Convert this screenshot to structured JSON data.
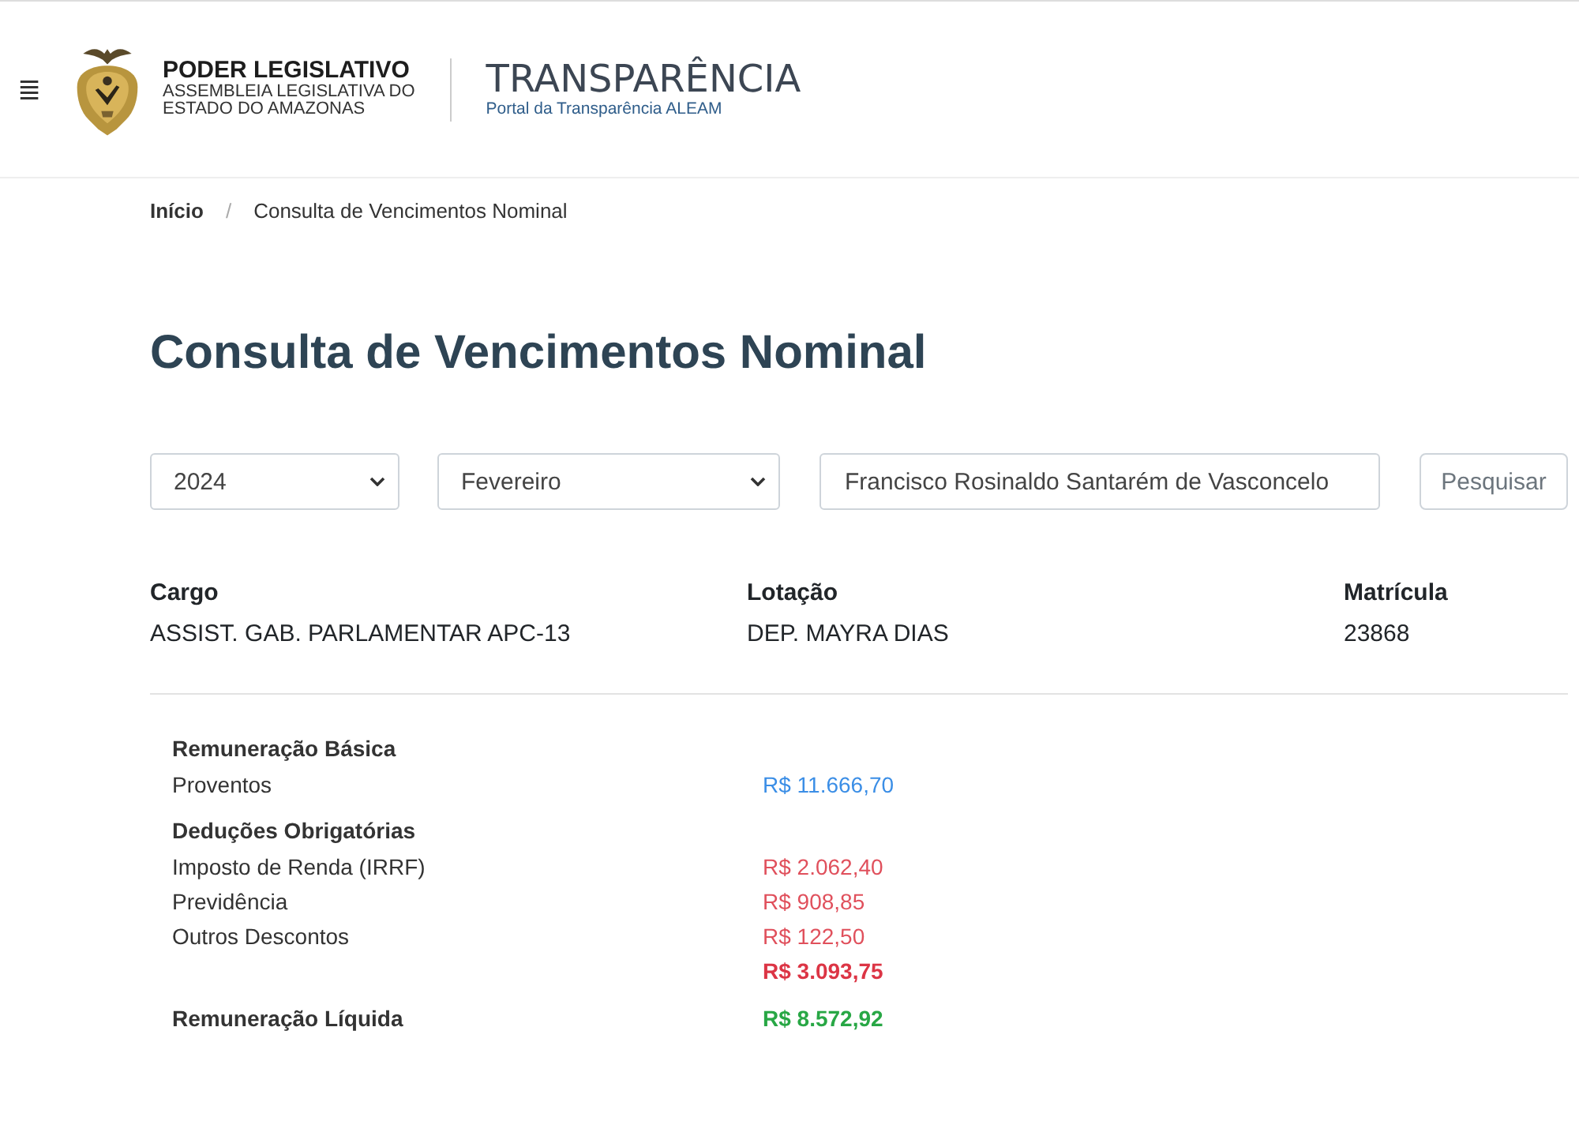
{
  "header": {
    "menu_icon": "≣",
    "org_title": "PODER LEGISLATIVO",
    "org_subtitle_1": "ASSEMBLEIA LEGISLATIVA DO",
    "org_subtitle_2": "ESTADO DO AMAZONAS",
    "portal_title": "TRANSPARÊNCIA",
    "portal_subtitle": "Portal da Transparência ALEAM"
  },
  "breadcrumb": [
    {
      "label": "Início",
      "selected": false
    },
    {
      "label": "Consulta de Vencimentos Nominal",
      "selected": true
    }
  ],
  "breadcrumb_separator": "/",
  "page_title": "Consulta de Vencimentos Nominal",
  "filters": {
    "year": "2024",
    "month": "Fevereiro",
    "name": "Francisco Rosinaldo Santarém de Vasconcelo",
    "search_button": "Pesquisar"
  },
  "info": [
    {
      "label": "Cargo",
      "value": "ASSIST. GAB. PARLAMENTAR APC-13"
    },
    {
      "label": "Lotação",
      "value": "DEP. MAYRA DIAS"
    },
    {
      "label": "Matrícula",
      "value": "23868"
    }
  ],
  "summary": [
    {
      "kind": "section",
      "label": "Remuneração Básica"
    },
    {
      "kind": "earning",
      "label": "Proventos",
      "amount": "R$ 11.666,70"
    },
    {
      "kind": "section",
      "label": "Deduções Obrigatórias"
    },
    {
      "kind": "deduction",
      "label": "Imposto de Renda (IRRF)",
      "amount": "R$ 2.062,40"
    },
    {
      "kind": "deduction",
      "label": "Previdência",
      "amount": "R$ 908,85"
    },
    {
      "kind": "deduction",
      "label": "Outros Descontos",
      "amount": "R$ 122,50"
    },
    {
      "kind": "deduction_total",
      "amount": "R$ 3.093,75"
    },
    {
      "kind": "net",
      "label": "Remuneração Líquida",
      "amount": "R$ 8.572,92"
    }
  ]
}
